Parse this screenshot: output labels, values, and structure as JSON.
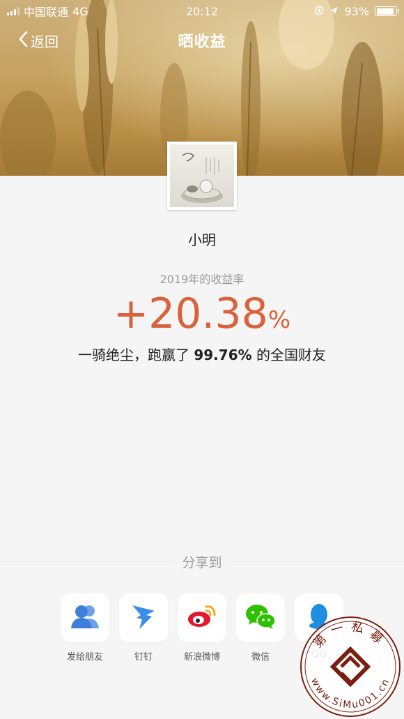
{
  "status_bar": {
    "carrier": "中国联通",
    "network": "4G",
    "time": "20:12",
    "battery": "93%"
  },
  "nav": {
    "back_label": "返回",
    "title": "晒收益"
  },
  "profile": {
    "username": "小明"
  },
  "earnings": {
    "year_label": "2019年的收益率",
    "rate_value": "+20.38",
    "rate_unit": "%",
    "beat_prefix": "一骑绝尘，跑赢了",
    "beat_percent": "99.76%",
    "beat_suffix": "的全国财友"
  },
  "share": {
    "title": "分享到",
    "items": [
      {
        "label": "发给朋友",
        "icon": "friends-icon"
      },
      {
        "label": "钉钉",
        "icon": "dingtalk-icon"
      },
      {
        "label": "新浪微博",
        "icon": "weibo-icon"
      },
      {
        "label": "微信",
        "icon": "wechat-icon"
      },
      {
        "label": "QQ",
        "icon": "qq-icon"
      }
    ]
  },
  "watermark": {
    "top_text": "第一私募",
    "bottom_text": "www.SiMu001.cn"
  },
  "colors": {
    "accent": "#d9623d",
    "background": "#f5f5f5"
  }
}
